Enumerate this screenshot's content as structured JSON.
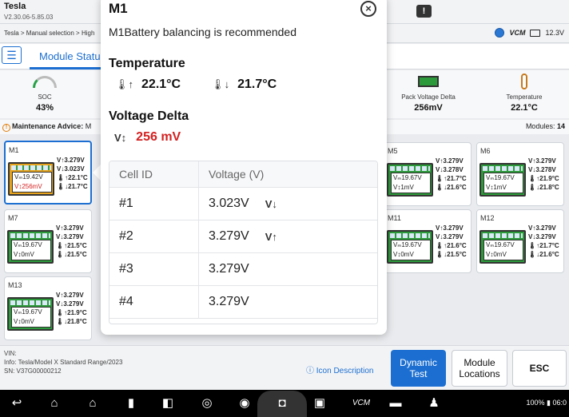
{
  "app": {
    "name": "Tesla",
    "version": "V2.30.06-5.85.03"
  },
  "breadcrumb": "Tesla > Manual selection > High",
  "status": {
    "vcm": "VCM",
    "voltage": "12.3V"
  },
  "header": {
    "tab": "Module Statu"
  },
  "summary": {
    "soc": {
      "label": "SOC",
      "value": "43%"
    },
    "pack_delta": {
      "label": "Pack Voltage Delta",
      "value": "256mV"
    },
    "temperature": {
      "label": "Temperature",
      "value": "22.1°C"
    }
  },
  "maintenance": {
    "label": "Maintenance Advice:",
    "value": "M",
    "modules_label": "Modules:",
    "modules_count": "14"
  },
  "modules": [
    {
      "id": "M1",
      "vm": "Vₘ19.42V",
      "vd": "V↕256mV",
      "v_up": "V↑3.279V",
      "v_down": "V↓3.023V",
      "t_up": "🌡↑22.1°C",
      "t_down": "🌡↓21.7°C",
      "warn": true
    },
    {
      "id": "M5",
      "vm": "Vₘ19.67V",
      "vd": "V↕1mV",
      "v_up": "V↑3.279V",
      "v_down": "V↓3.278V",
      "t_up": "🌡↑21.7°C",
      "t_down": "🌡↓21.6°C",
      "warn": false
    },
    {
      "id": "M6",
      "vm": "Vₘ19.67V",
      "vd": "V↕1mV",
      "v_up": "V↑3.279V",
      "v_down": "V↓3.278V",
      "t_up": "🌡↑21.9°C",
      "t_down": "🌡↓21.8°C",
      "warn": false
    },
    {
      "id": "M7",
      "vm": "Vₘ19.67V",
      "vd": "V↕0mV",
      "v_up": "V↑3.279V",
      "v_down": "V↓3.279V",
      "t_up": "🌡↑21.5°C",
      "t_down": "🌡↓21.5°C",
      "warn": false
    },
    {
      "id": "M11",
      "vm": "Vₘ19.67V",
      "vd": "V↕0mV",
      "v_up": "V↑3.279V",
      "v_down": "V↓3.279V",
      "t_up": "🌡↑21.6°C",
      "t_down": "🌡↓21.5°C",
      "warn": false
    },
    {
      "id": "M12",
      "vm": "Vₘ19.67V",
      "vd": "V↕0mV",
      "v_up": "V↑3.279V",
      "v_down": "V↓3.279V",
      "t_up": "🌡↑21.7°C",
      "t_down": "🌡↓21.6°C",
      "warn": false
    },
    {
      "id": "M13",
      "vm": "Vₘ19.67V",
      "vd": "V↕0mV",
      "v_up": "V↑3.279V",
      "v_down": "V↓3.279V",
      "t_up": "🌡↑21.9°C",
      "t_down": "🌡↓21.8°C",
      "warn": false
    }
  ],
  "bottom": {
    "vin": "VIN:",
    "info": "Info: Tesla/Model X Standard Range/2023",
    "sn": "SN: V37G00000212",
    "icon_desc": "Icon Description",
    "btn_dynamic": "Dynamic Test",
    "btn_locations": "Module Locations",
    "btn_esc": "ESC"
  },
  "nav": {
    "status": "100% ▮ 06:0"
  },
  "popup": {
    "title": "M1",
    "advice": "M1Battery balancing is recommended",
    "temp_heading": "Temperature",
    "temp_high": "22.1°C",
    "temp_low": "21.7°C",
    "vd_heading": "Voltage Delta",
    "vd_value": "256 mV",
    "table": {
      "col_cell": "Cell ID",
      "col_voltage": "Voltage (V)",
      "rows": [
        {
          "id": "#1",
          "v": "3.023V",
          "mark": "V↓"
        },
        {
          "id": "#2",
          "v": "3.279V",
          "mark": "V↑"
        },
        {
          "id": "#3",
          "v": "3.279V",
          "mark": ""
        },
        {
          "id": "#4",
          "v": "3.279V",
          "mark": ""
        }
      ]
    }
  }
}
